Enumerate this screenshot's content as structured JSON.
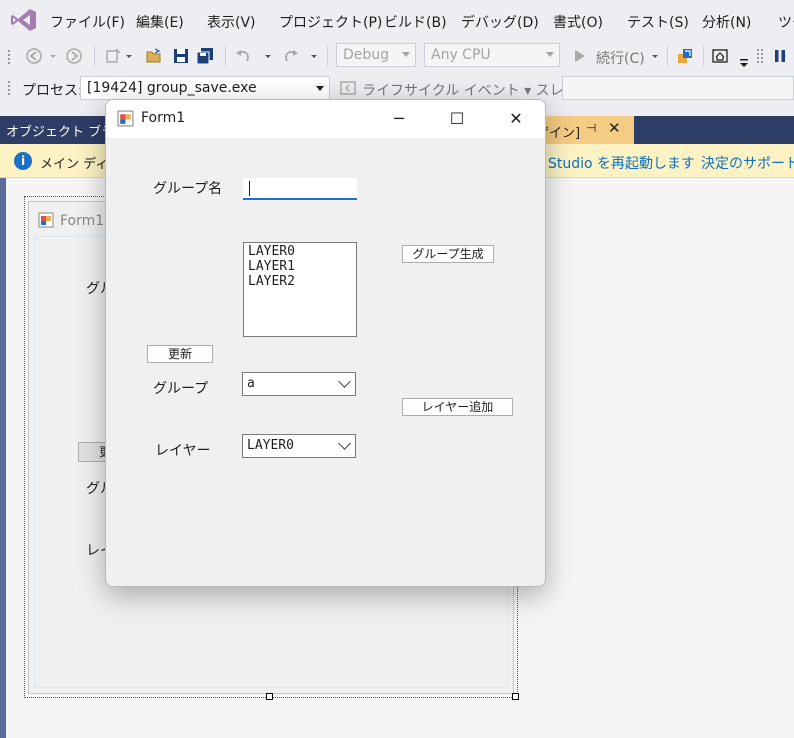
{
  "menu": [
    "ファイル(F)",
    "編集(E)",
    "表示(V)",
    "プロジェクト(P)",
    "ビルド(B)",
    "デバッグ(D)",
    "書式(O)",
    "テスト(S)",
    "分析(N)",
    "ツー"
  ],
  "toolbar": {
    "config": "Debug",
    "platform": "Any CPU",
    "continue_label": "続行(C)"
  },
  "debugbar": {
    "process_label": "プロセス:",
    "process_value": "[19424] group_save.exe",
    "lifecycle_label": "ライフサイクル イベント ▾ スレッド:"
  },
  "tabs": {
    "object_browser": "オブジェクト ブラウ",
    "design_suffix": "ザイン]",
    "pin": "⊣",
    "close": "✕"
  },
  "infobar": {
    "icon": "i",
    "text": "メイン ディス",
    "restart_link": "Studio を再起動します",
    "support_link": "決定のサポート"
  },
  "design_form": {
    "title": "Form1",
    "labels": [
      "グル",
      "グル",
      "レイ"
    ],
    "button_fragment": "更"
  },
  "form": {
    "title": "Form1",
    "controls": {
      "minimize": "─",
      "maximize": "☐",
      "close": "✕"
    },
    "group_name_label": "グループ名",
    "group_name_value": "",
    "layers": [
      "LAYER0",
      "LAYER1",
      "LAYER2"
    ],
    "create_group_button": "グループ生成",
    "refresh_button": "更新",
    "group_label": "グループ",
    "group_value": "a",
    "add_layer_button": "レイヤー追加",
    "layer_label": "レイヤー",
    "layer_value": "LAYER0"
  },
  "colors": {
    "tab_strip": "#2d3e66",
    "active_tab": "#f5cc84",
    "info_bar": "#fcf2c4",
    "accent": "#1e6fc8"
  }
}
